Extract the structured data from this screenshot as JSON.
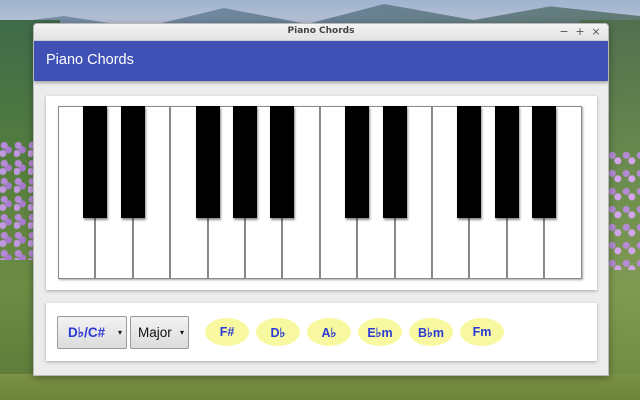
{
  "window": {
    "title": "Piano Chords",
    "controls": {
      "minimize": "−",
      "maximize": "+",
      "close": "×"
    }
  },
  "appbar": {
    "title": "Piano Chords"
  },
  "piano": {
    "white_key_count": 14,
    "black_key_after_white_index": [
      0,
      1,
      3,
      4,
      5,
      7,
      8,
      10,
      11,
      12
    ]
  },
  "controls": {
    "root_note": "D♭/C#",
    "quality": "Major",
    "dropdown_arrow": "▾"
  },
  "chords": [
    "F#",
    "D♭",
    "A♭",
    "E♭m",
    "B♭m",
    "Fm"
  ],
  "colors": {
    "appbar": "#3f51b5",
    "accent_text": "#2a3ad6",
    "chord_bubble": "#f8f8a0"
  }
}
